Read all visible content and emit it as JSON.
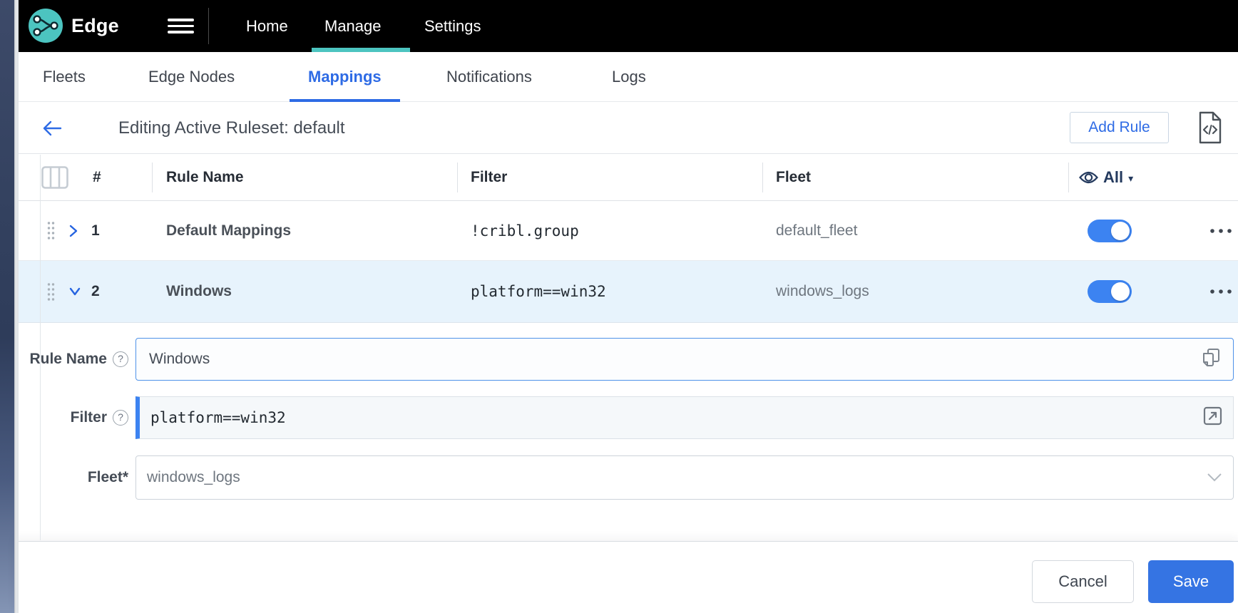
{
  "topbar": {
    "brand": "Edge",
    "nav": [
      {
        "label": "Home"
      },
      {
        "label": "Manage",
        "active": true
      },
      {
        "label": "Settings"
      }
    ]
  },
  "subtabs": [
    {
      "label": "Fleets"
    },
    {
      "label": "Edge Nodes"
    },
    {
      "label": "Mappings",
      "active": true
    },
    {
      "label": "Notifications"
    },
    {
      "label": "Logs"
    }
  ],
  "ruleset": {
    "title": "Editing Active Ruleset: default",
    "add_rule_label": "Add Rule"
  },
  "table": {
    "col_number": "#",
    "col_rule_name": "Rule Name",
    "col_filter": "Filter",
    "col_fleet": "Fleet",
    "visibility_label": "All",
    "visibility_caret": "▾"
  },
  "rows": [
    {
      "number": "1",
      "name": "Default Mappings",
      "filter": "!cribl.group",
      "fleet": "default_fleet",
      "enabled": true
    },
    {
      "number": "2",
      "name": "Windows",
      "filter": "platform==win32",
      "fleet": "windows_logs",
      "enabled": true
    }
  ],
  "form": {
    "rule_name_label": "Rule Name",
    "rule_name_value": "Windows",
    "filter_label": "Filter",
    "filter_value": "platform==win32",
    "fleet_label": "Fleet*",
    "fleet_value": "windows_logs",
    "help_glyph": "?"
  },
  "footer": {
    "cancel_label": "Cancel",
    "save_label": "Save"
  },
  "colors": {
    "accent_blue": "#2e6be5",
    "teal": "#4cc4c0",
    "toggle_blue": "#3c83f1",
    "row_highlight": "#e7f3fc",
    "save_blue": "#3574e3"
  }
}
